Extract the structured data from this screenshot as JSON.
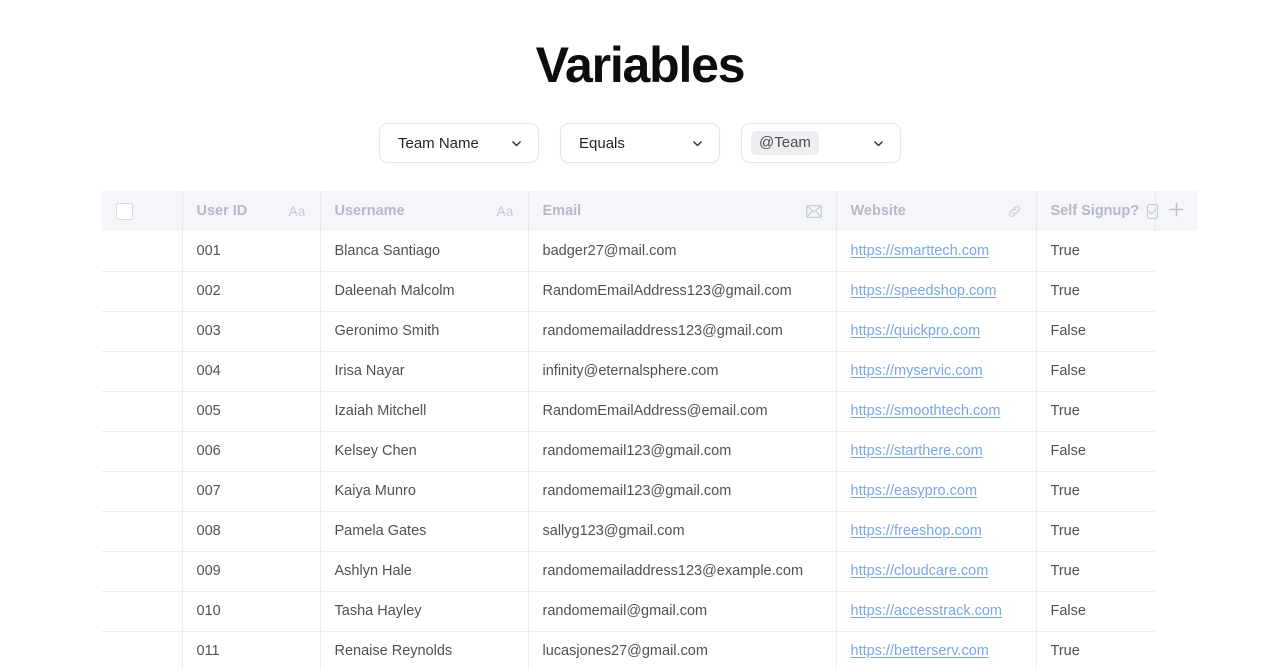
{
  "page": {
    "title": "Variables"
  },
  "filter": {
    "field": {
      "label": "Team Name",
      "icon": "chevron-down-icon"
    },
    "operator": {
      "label": "Equals",
      "icon": "chevron-down-icon"
    },
    "value": {
      "label": "@Team",
      "icon": "chevron-down-icon"
    }
  },
  "table": {
    "select_all_checkbox": "",
    "add_column_label": "+",
    "columns": [
      {
        "key": "checkbox",
        "label": "",
        "icon": "checkbox-icon"
      },
      {
        "key": "user_id",
        "label": "User ID",
        "icon": "text-aa-icon",
        "icon_text": "Aa"
      },
      {
        "key": "username",
        "label": "Username",
        "icon": "text-aa-icon",
        "icon_text": "Aa"
      },
      {
        "key": "email",
        "label": "Email",
        "icon": "envelope-icon"
      },
      {
        "key": "website",
        "label": "Website",
        "icon": "link-icon"
      },
      {
        "key": "self_signup",
        "label": "Self Signup?",
        "icon": "checkbox-checked-icon"
      },
      {
        "key": "add",
        "label": "",
        "icon": "plus-icon"
      }
    ],
    "rows": [
      {
        "user_id": "001",
        "username": "Blanca Santiago",
        "email": "badger27@mail.com",
        "website": "https://smarttech.com",
        "self_signup": "True"
      },
      {
        "user_id": "002",
        "username": "Daleenah Malcolm",
        "email": "RandomEmailAddress123@gmail.com",
        "website": "https://speedshop.com",
        "self_signup": "True"
      },
      {
        "user_id": "003",
        "username": "Geronimo Smith",
        "email": "randomemailaddress123@gmail.com",
        "website": "https://quickpro.com",
        "self_signup": "False"
      },
      {
        "user_id": "004",
        "username": "Irisa Nayar",
        "email": "infinity@eternalsphere.com",
        "website": "https://myservic.com",
        "self_signup": "False"
      },
      {
        "user_id": "005",
        "username": "Izaiah Mitchell",
        "email": "RandomEmailAddress@email.com",
        "website": "https://smoothtech.com",
        "self_signup": "True"
      },
      {
        "user_id": "006",
        "username": "Kelsey Chen",
        "email": "randomemail123@gmail.com",
        "website": "https://starthere.com",
        "self_signup": "False"
      },
      {
        "user_id": "007",
        "username": "Kaiya Munro",
        "email": "randomemail123@gmail.com",
        "website": "https://easypro.com",
        "self_signup": "True"
      },
      {
        "user_id": "008",
        "username": "Pamela Gates",
        "email": "sallyg123@gmail.com",
        "website": "https://freeshop.com",
        "self_signup": "True"
      },
      {
        "user_id": "009",
        "username": "Ashlyn Hale",
        "email": "randomemailaddress123@example.com",
        "website": "https://cloudcare.com",
        "self_signup": "True"
      },
      {
        "user_id": "010",
        "username": "Tasha Hayley",
        "email": "randomemail@gmail.com",
        "website": "https://accesstrack.com",
        "self_signup": "False"
      },
      {
        "user_id": "011",
        "username": "Renaise Reynolds",
        "email": "lucasjones27@gmail.com",
        "website": "https://betterserv.com",
        "self_signup": "True"
      }
    ]
  },
  "colors": {
    "link": "#7ba6e6",
    "header_bg": "#f4f6f9",
    "header_text": "#b2bac6",
    "body_text": "#4e5257",
    "border": "#ecedef"
  }
}
